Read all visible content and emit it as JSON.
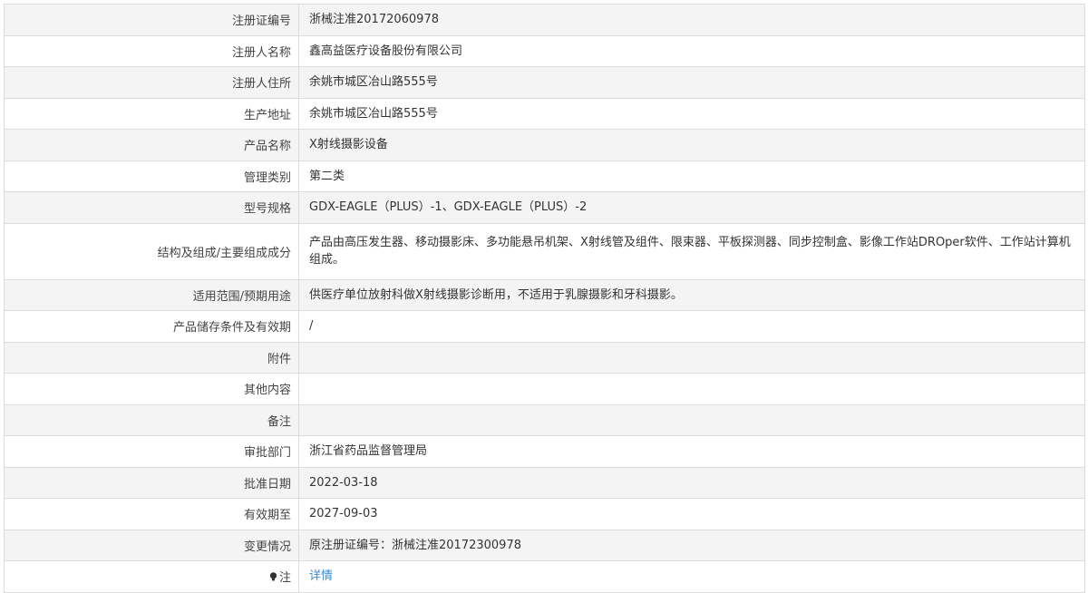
{
  "rows": [
    {
      "label": "注册证编号",
      "value": "浙械注准20172060978"
    },
    {
      "label": "注册人名称",
      "value": "鑫高益医疗设备股份有限公司"
    },
    {
      "label": "注册人住所",
      "value": "余姚市城区冶山路555号"
    },
    {
      "label": "生产地址",
      "value": "余姚市城区冶山路555号"
    },
    {
      "label": "产品名称",
      "value": "X射线摄影设备"
    },
    {
      "label": "管理类别",
      "value": "第二类"
    },
    {
      "label": "型号规格",
      "value": "GDX-EAGLE（PLUS）-1、GDX-EAGLE（PLUS）-2"
    },
    {
      "label": "结构及组成/主要组成成分",
      "value": "产品由高压发生器、移动摄影床、多功能悬吊机架、X射线管及组件、限束器、平板探测器、同步控制盒、影像工作站DROper软件、工作站计算机组成。"
    },
    {
      "label": "适用范围/预期用途",
      "value": "供医疗单位放射科做X射线摄影诊断用，不适用于乳腺摄影和牙科摄影。"
    },
    {
      "label": "产品储存条件及有效期",
      "value": "/"
    },
    {
      "label": "附件",
      "value": ""
    },
    {
      "label": "其他内容",
      "value": ""
    },
    {
      "label": "备注",
      "value": ""
    },
    {
      "label": "审批部门",
      "value": "浙江省药品监督管理局"
    },
    {
      "label": "批准日期",
      "value": "2022-03-18"
    },
    {
      "label": "有效期至",
      "value": "2027-09-03"
    },
    {
      "label": "变更情况",
      "value": "原注册证编号：浙械注准20172300978"
    }
  ],
  "note_row": {
    "label": "注",
    "icon": "lightbulb-icon",
    "link_text": "详情"
  }
}
